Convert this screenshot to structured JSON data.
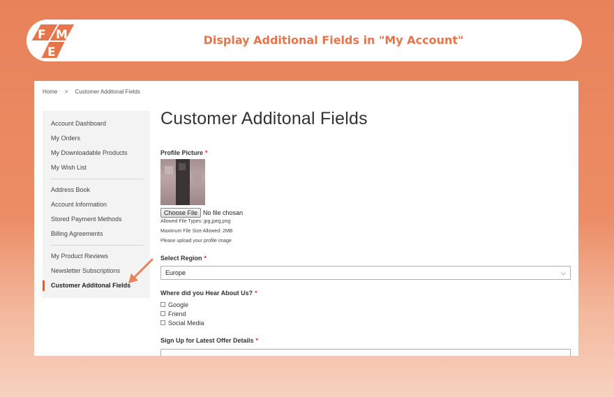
{
  "banner": {
    "title": "Display Additional Fields in \"My Account\"",
    "logo_text": "FME",
    "accent": "#e8744a"
  },
  "breadcrumb": {
    "home": "Home",
    "separator": ">",
    "current": "Customer Additonal Fields"
  },
  "sidebar": {
    "groups": [
      [
        "Account Dashboard",
        "My Orders",
        "My Downloadable Products",
        "My Wish List"
      ],
      [
        "Address Book",
        "Account Information",
        "Stored Payment Methods",
        "Billing Agreements"
      ],
      [
        "My Product Reviews",
        "Newsletter Subscriptions",
        "Customer Additonal Fields"
      ]
    ],
    "active": "Customer Additonal Fields"
  },
  "main": {
    "title": "Customer Additonal Fields",
    "profile": {
      "label": "Profile Picture",
      "required": "*",
      "choose_file": "Choose File",
      "no_file": "No file chosan",
      "allowed_types": "Allowed File Types: jpg,jpeg,png",
      "max_size": "Maximum File Size Allowed: 2MB",
      "hint": "Please upload your profile image"
    },
    "region": {
      "label": "Select Region",
      "required": "*",
      "value": "Europe"
    },
    "hear": {
      "label": "Where did you Hear About Us?",
      "required": "*",
      "options": [
        "Google",
        "Friend",
        "Social Media"
      ]
    },
    "signup": {
      "label": "Sign Up for Latest Offer Details",
      "required": "*"
    }
  },
  "colors": {
    "background": "#e8825a",
    "active_marker": "#ff5501",
    "required": "#e02b27"
  }
}
